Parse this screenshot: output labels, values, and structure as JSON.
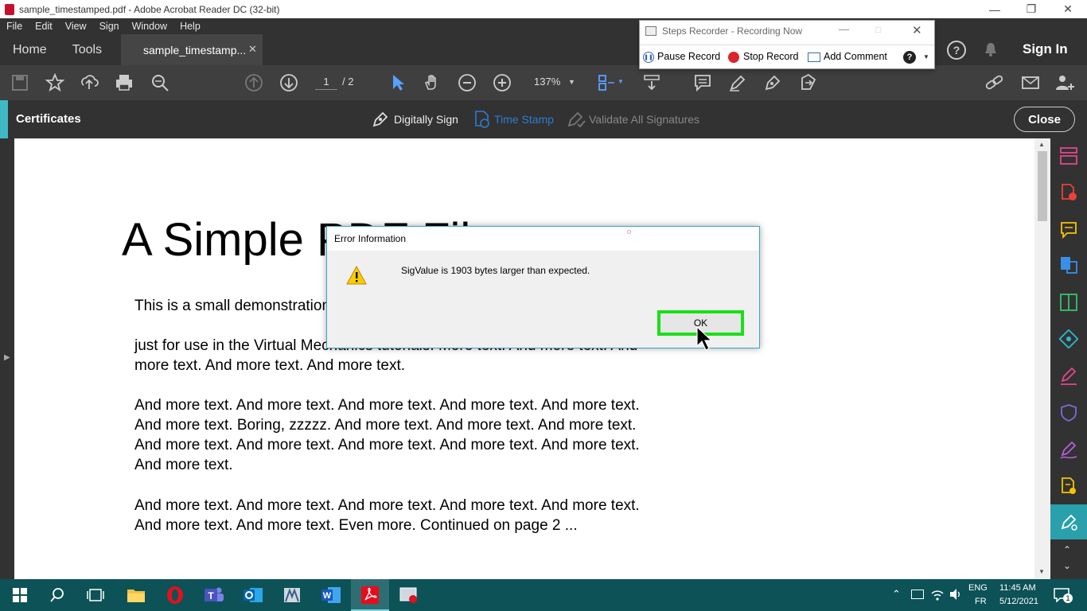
{
  "window": {
    "title": "sample_timestamped.pdf - Adobe Acrobat Reader DC (32-bit)"
  },
  "menu": [
    "File",
    "Edit",
    "View",
    "Sign",
    "Window",
    "Help"
  ],
  "tabs": {
    "home": "Home",
    "tools": "Tools",
    "document": "sample_timestamp..."
  },
  "header": {
    "sign_in": "Sign In"
  },
  "toolbar": {
    "page_current": "1",
    "page_total": "/ 2",
    "zoom": "137%"
  },
  "certbar": {
    "title": "Certificates",
    "digitally_sign": "Digitally Sign",
    "time_stamp": "Time Stamp",
    "validate": "Validate All Signatures",
    "close": "Close"
  },
  "document": {
    "heading": "A Simple PDF File",
    "p1": "This is a small demonstration .pdf file -",
    "p2": "just for use in the Virtual Mechanics tutorials. More text. And more text. And more text. And more text. And more text.",
    "p3": "And more text. And more text. And more text. And more text. And more text. And more text. Boring, zzzzz. And more text. And more text. And more text. And more text. And more text. And more text. And more text. And more text. And more text.",
    "p4": "And more text. And more text. And more text. And more text. And more text. And more text. And more text. Even more. Continued on page 2 ..."
  },
  "dialog": {
    "title": "Error Information",
    "message": "SigValue is 1903 bytes larger than expected.",
    "ok": "OK"
  },
  "steps_recorder": {
    "title": "Steps Recorder - Recording Now",
    "pause": "Pause Record",
    "stop": "Stop Record",
    "comment": "Add Comment"
  },
  "taskbar": {
    "lang1": "ENG",
    "lang2": "FR",
    "time": "11:45 AM",
    "date": "5/12/2021",
    "notif": "1"
  },
  "colors": {
    "accent": "#3fb9c5",
    "highlight": "#19e019",
    "taskbar": "#0c5257"
  }
}
